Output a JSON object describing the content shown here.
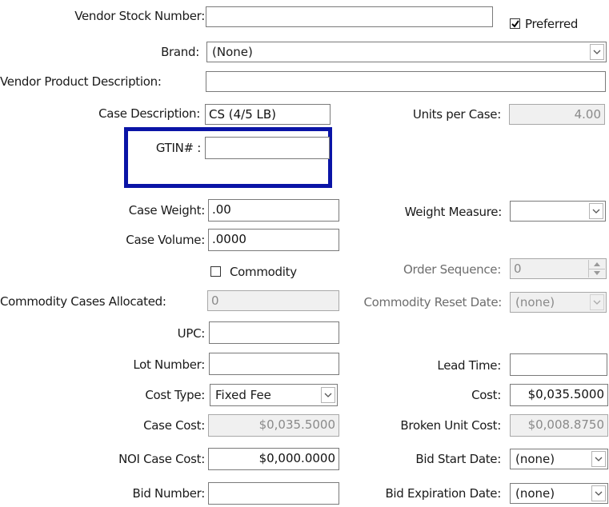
{
  "fields": {
    "vendor_stock_number": {
      "label": "Vendor Stock Number:",
      "value": ""
    },
    "preferred": {
      "label": "Preferred",
      "checked": true
    },
    "brand": {
      "label": "Brand:",
      "value": "(None)"
    },
    "vendor_product_description": {
      "label": "Vendor Product Description:",
      "value": ""
    },
    "case_description": {
      "label": "Case Description:",
      "value": "CS (4/5 LB)"
    },
    "units_per_case": {
      "label": "Units per Case:",
      "value": "4.00"
    },
    "gtin": {
      "label": "GTIN# :",
      "value": ""
    },
    "case_weight": {
      "label": "Case Weight:",
      "value": ".00"
    },
    "weight_measure": {
      "label": "Weight Measure:",
      "value": ""
    },
    "case_volume": {
      "label": "Case Volume:",
      "value": ".0000"
    },
    "commodity": {
      "label": "Commodity",
      "checked": false
    },
    "order_sequence": {
      "label": "Order Sequence:",
      "value": "0"
    },
    "commodity_cases_allocated": {
      "label": "Commodity Cases Allocated:",
      "value": "0"
    },
    "commodity_reset_date": {
      "label": "Commodity Reset Date:",
      "value": "(none)"
    },
    "upc": {
      "label": "UPC:",
      "value": ""
    },
    "lot_number": {
      "label": "Lot Number:",
      "value": ""
    },
    "lead_time": {
      "label": "Lead Time:",
      "value": ""
    },
    "cost_type": {
      "label": "Cost Type:",
      "value": "Fixed Fee"
    },
    "cost": {
      "label": "Cost:",
      "value": "$0,035.5000"
    },
    "case_cost": {
      "label": "Case Cost:",
      "value": "$0,035.5000"
    },
    "broken_unit_cost": {
      "label": "Broken Unit Cost:",
      "value": "$0,008.8750"
    },
    "noi_case_cost": {
      "label": "NOI Case Cost:",
      "value": "$0,000.0000"
    },
    "bid_start_date": {
      "label": "Bid Start Date:",
      "value": "(none)"
    },
    "bid_number": {
      "label": "Bid Number:",
      "value": ""
    },
    "bid_expiration_date": {
      "label": "Bid Expiration Date:",
      "value": "(none)"
    }
  },
  "colors": {
    "highlight": "#0a14a6",
    "disabled_bg": "#f0f0f0"
  },
  "icons": {
    "dropdown": "chevron-down-icon",
    "spinner": "spinner-arrows-icon",
    "checkbox": "checkmark-icon"
  }
}
